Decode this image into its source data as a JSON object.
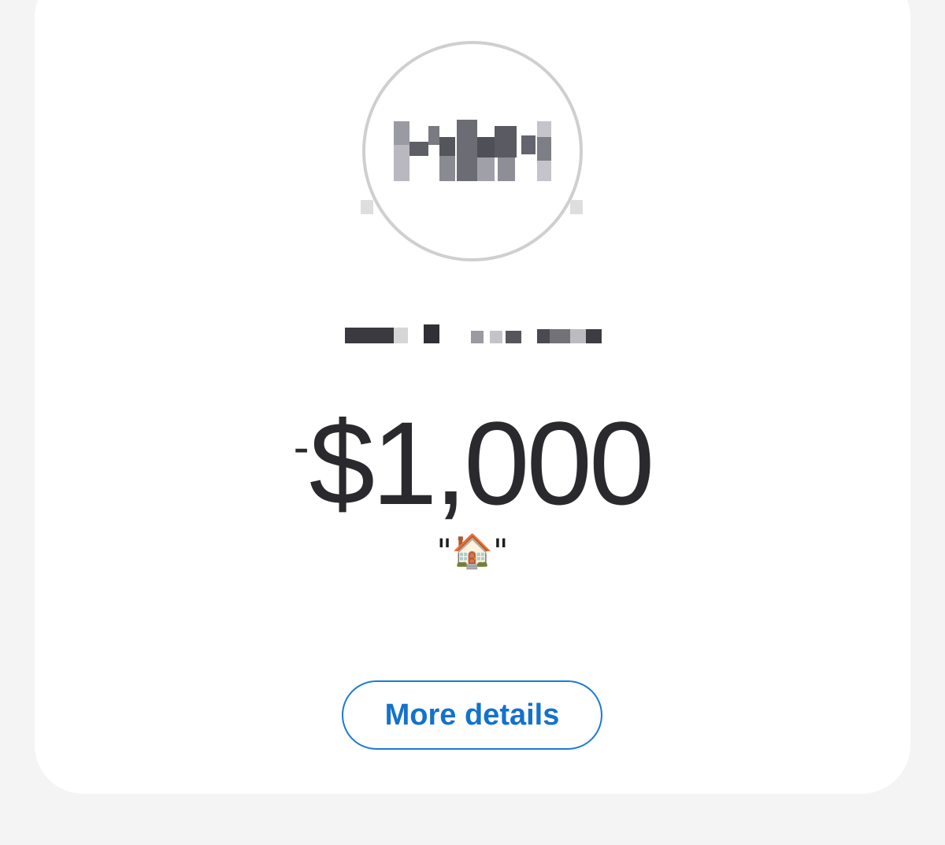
{
  "transaction": {
    "recipient_name": "",
    "amount_sign": "-",
    "amount_value": "$1,000",
    "note": "\"🏠\""
  },
  "actions": {
    "more_details_label": "More details"
  },
  "colors": {
    "accent": "#1472cc",
    "amount_text": "#2a2a2e",
    "card_bg": "#ffffff",
    "page_bg": "#f4f4f4"
  }
}
